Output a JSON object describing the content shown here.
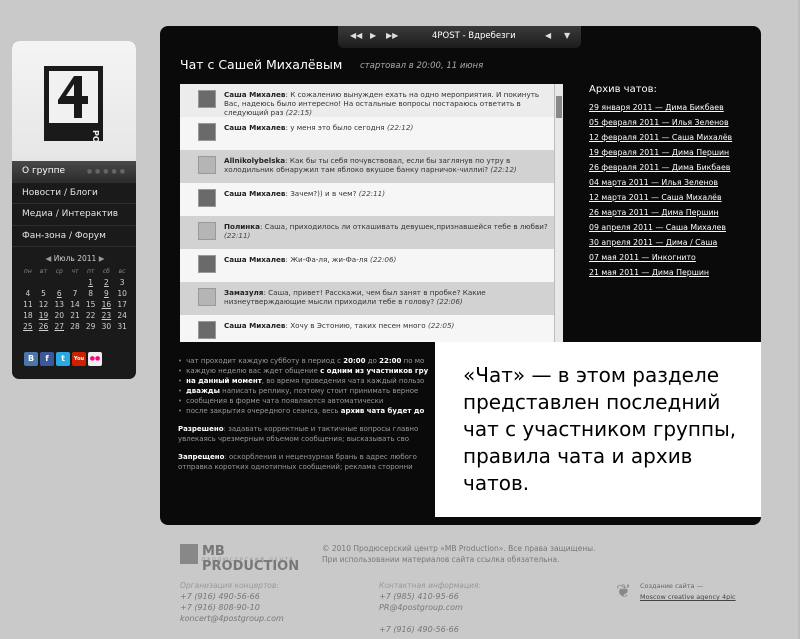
{
  "player": {
    "prev": "◀◀",
    "play": "▶",
    "next": "▶▶",
    "track": "4POST - Вдребезги",
    "left": "◀",
    "down": "▼"
  },
  "sidebar": {
    "logo_text": "POST",
    "nav": [
      {
        "label": "О группе"
      },
      {
        "label": "Новости / Блоги"
      },
      {
        "label": "Медиа / Интерактив"
      },
      {
        "label": "Фан-зона / Форум"
      }
    ],
    "calendar": {
      "month": "Июль 2011",
      "prev": "◀",
      "next": "▶",
      "days": [
        "пн",
        "вт",
        "ср",
        "чт",
        "пт",
        "сб",
        "вс"
      ],
      "weeks": [
        [
          "",
          "",
          "",
          "",
          "1",
          "2",
          "3"
        ],
        [
          "4",
          "5",
          "6",
          "7",
          "8",
          "9",
          "10"
        ],
        [
          "11",
          "12",
          "13",
          "14",
          "15",
          "16",
          "17"
        ],
        [
          "18",
          "19",
          "20",
          "21",
          "22",
          "23",
          "24"
        ],
        [
          "25",
          "26",
          "27",
          "28",
          "29",
          "30",
          "31"
        ]
      ]
    },
    "social": [
      {
        "label": "В",
        "color": "#4a76a8"
      },
      {
        "label": "f",
        "color": "#3b5998"
      },
      {
        "label": "t",
        "color": "#2aa9e0"
      },
      {
        "label": "You",
        "color": "#cc2200"
      },
      {
        "label": "●●",
        "color": "#ff0084"
      }
    ]
  },
  "chat": {
    "title": "Чат с Сашей Михалёвым",
    "subtitle": "стартовал в 20:00, 11 июня",
    "messages": [
      {
        "author": "Саша Михалев",
        "text": "К сожалению вынужден ехать на одно мероприятия. И покинуть Вас, надеюсь было интересно! На остальные вопросы постараюсь ответить в следующий раз",
        "time": "(22:15)"
      },
      {
        "author": "Саша Михалев",
        "text": "у меня это было сегодня",
        "time": "(22:12)"
      },
      {
        "author": "Allnikolybelska",
        "text": "Как бы ты себя почувствовал, если бы заглянув по утру в холодильник обнаружил там яблоко вкушое банку парничок-чиллиi?",
        "time": "(22:12)"
      },
      {
        "author": "Саша Михалев",
        "text": "Зачем?)) и в чем?",
        "time": "(22:11)"
      },
      {
        "author": "Полинка",
        "text": "Саша, приходилось ли откашивать девушек,признавшейся тебе в любви?",
        "time": "(22:11)"
      },
      {
        "author": "Саша Михалев",
        "text": "Жи-Фа-ля, жи-Фа-ля",
        "time": "(22:06)"
      },
      {
        "author": "Замазуля",
        "text": "Саша, привет! Расскажи, чем был занят в пробке? Какие низнеутверждающие мысли приходили тебе в голову?",
        "time": "(22:06)"
      },
      {
        "author": "Саша Михалев",
        "text": "Хочу в Эстонию, таких песен много",
        "time": "(22:05)"
      }
    ]
  },
  "archive": {
    "title": "Архив чатов:",
    "items": [
      "29 января 2011 — Дима Бикбаев",
      "05 февраля 2011 — Илья Зеленов",
      "12 февраля 2011 — Саша Михалёв",
      "19 февраля 2011 — Дима Першин",
      "26 февраля 2011 — Дима Бикбаев",
      "04 марта 2011 — Илья Зеленов",
      "12 марта 2011 — Саша Михалёв",
      "26 марта 2011 — Дима Першин",
      "09 апреля 2011 — Саша Михалев",
      "30 апреля 2011 — Дима / Саша",
      "07 мая 2011 — Инкогнито",
      "21 мая 2011 — Дима Першин"
    ]
  },
  "rules": {
    "items": [
      {
        "pre": "чат проходит каждую субботу в период с ",
        "b1": "20:00",
        "mid": " до ",
        "b2": "22:00",
        "post": " по мо"
      },
      {
        "pre": "каждую неделю вас ждет общение ",
        "b1": "с одним из участников гру",
        "mid": "",
        "b2": "",
        "post": ""
      },
      {
        "pre": "",
        "b1": "на данный момент",
        "mid": ", во время проведения чата каждый пользо",
        "b2": "",
        "post": ""
      },
      {
        "pre": "",
        "b1": "дважды",
        "mid": " написать реплику, поэтому стоит принимать верное ",
        "b2": "",
        "post": ""
      },
      {
        "pre": "сообщения в форме чата появляются автоматически",
        "b1": "",
        "mid": "",
        "b2": "",
        "post": ""
      },
      {
        "pre": "после закрытия очередного сеанса, весь ",
        "b1": "архив чата будет до",
        "mid": "",
        "b2": "",
        "post": ""
      }
    ],
    "allowed_label": "Разрешено",
    "allowed_text": ": задавать корректные и тактичные вопросы главно",
    "allowed_text2": "увлекаясь чрезмерным объемом сообщения; высказывать сво",
    "forbidden_label": "Запрещено",
    "forbidden_text": ": оскорбления и нецензурная брань в адрес любого",
    "forbidden_text2": "отправка коротких однотипных сообщений; реклама сторонни"
  },
  "overlay": {
    "text": "«Чат» — в этом разделе представлен последний чат с участником группы, правила чата и архив чатов."
  },
  "footer": {
    "logo_text": "MB PRODUCTION",
    "logo_sub": "ПРОДЮСЕРСКИЙ ЦЕНТР",
    "copyright1": "© 2010 Продюсерский центр «MB Production». Все права защищены.",
    "copyright2": "При использовании материалов сайта ссылка обязательна.",
    "org_label": "Организация концертов:",
    "org_phone1": "+7 (916) 490-56-66",
    "org_phone2": "+7 (916) 808-90-10",
    "org_email": "koncert@4postgroup.com",
    "contact_label": "Контактная информация:",
    "contact_phone": "+7 (985) 410-95-66",
    "contact_email": "PR@4postgroup.com",
    "contact_phone2": "+7 (916) 490-56-66",
    "made_label": "Создание сайта —",
    "made_link": "Moscow creative agency 4pic"
  }
}
